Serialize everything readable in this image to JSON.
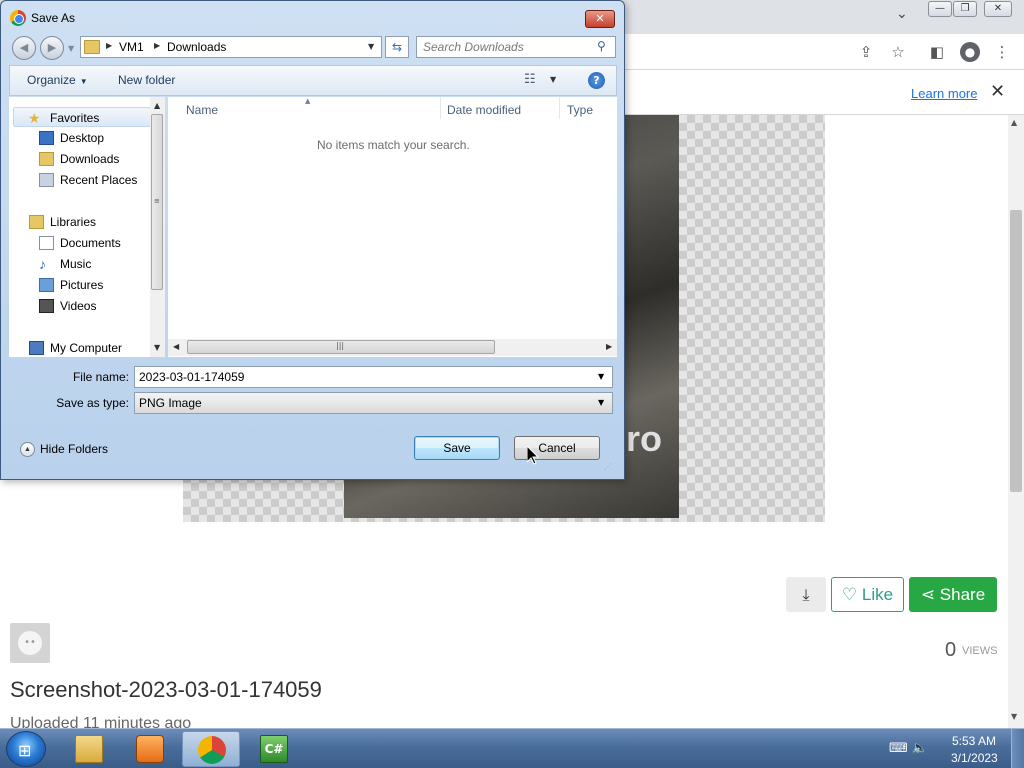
{
  "browser": {
    "info_bar": {
      "learn_more": "Learn more",
      "close_glyph": "✕"
    },
    "page": {
      "photo_text": "ro",
      "buttons": {
        "like": "Like",
        "share": "Share"
      },
      "views": {
        "count": "0",
        "label": "VIEWS"
      },
      "title": "Screenshot-2023-03-01-174059",
      "uploaded": "Uploaded 11 minutes ago"
    }
  },
  "dialog": {
    "title": "Save As",
    "address": {
      "crumbs": [
        "VM1",
        "Downloads"
      ]
    },
    "search": {
      "placeholder": "Search Downloads"
    },
    "commands": {
      "organize": "Organize",
      "new_folder": "New folder"
    },
    "nav": {
      "groups": [
        {
          "label": "Favorites",
          "items": [
            "Desktop",
            "Downloads",
            "Recent Places"
          ]
        },
        {
          "label": "Libraries",
          "items": [
            "Documents",
            "Music",
            "Pictures",
            "Videos"
          ]
        },
        {
          "label": "My Computer",
          "items": []
        }
      ]
    },
    "columns": [
      "Name",
      "Date modified",
      "Type"
    ],
    "empty_message": "No items match your search.",
    "file_name": {
      "label": "File name:",
      "value": "2023-03-01-174059"
    },
    "save_as_type": {
      "label": "Save as type:",
      "value": "PNG Image"
    },
    "hide_folders": "Hide Folders",
    "buttons": {
      "save": "Save",
      "cancel": "Cancel"
    }
  },
  "taskbar": {
    "apps": [
      "file-explorer",
      "media-player",
      "chrome",
      "csharp-editor"
    ],
    "clock": {
      "time": "5:53 AM",
      "date": "3/1/2023"
    }
  },
  "colors": {
    "share_green": "#28a745",
    "like_teal": "#2c9f82",
    "link_blue": "#1a73e8"
  }
}
